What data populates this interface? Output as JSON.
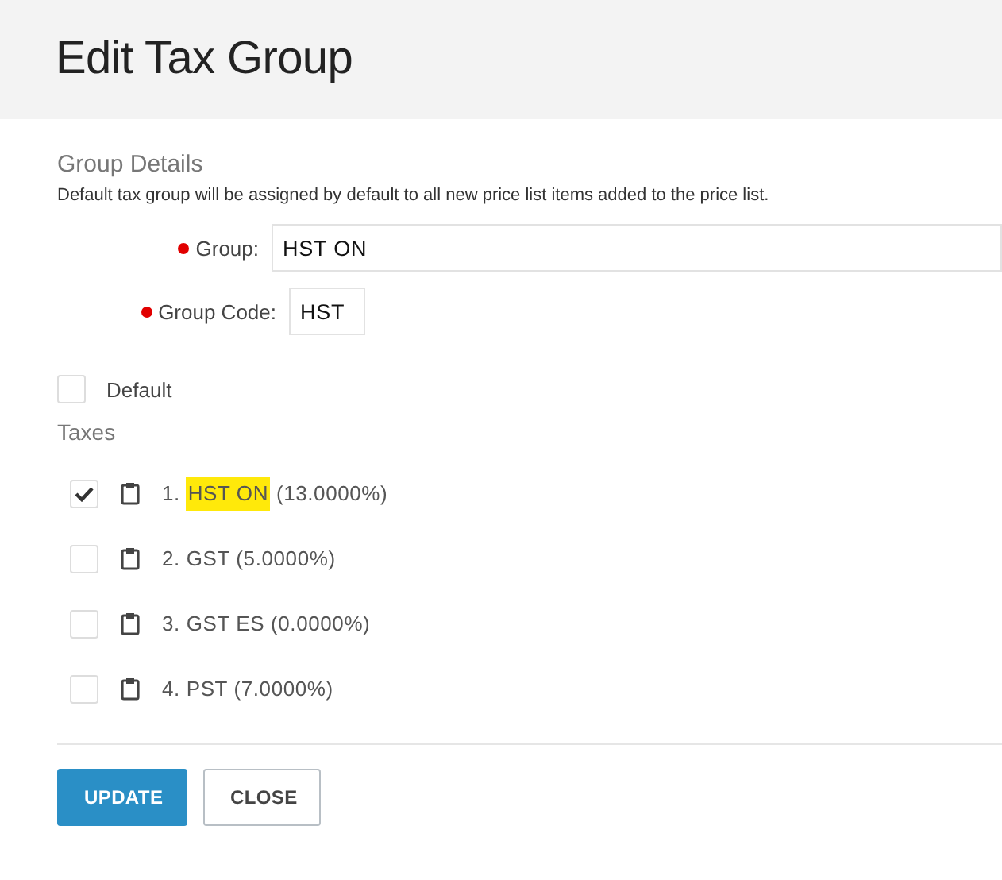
{
  "title": "Edit Tax Group",
  "section": {
    "heading": "Group Details",
    "description": "Default tax group will be assigned by default to all new price list items added to the price list."
  },
  "fields": [
    {
      "label": "Group:",
      "value": "HST ON",
      "required": true,
      "kind": "wide"
    },
    {
      "label": "Group Code:",
      "value": "HST",
      "required": true,
      "kind": "short"
    }
  ],
  "default_option": {
    "label": "Default",
    "checked": false
  },
  "taxes_heading": "Taxes",
  "taxes": [
    {
      "number": "1.",
      "name": "HST ON",
      "rate": "(13.0000%)",
      "checked": true,
      "highlighted": true
    },
    {
      "number": "2.",
      "name": "GST",
      "rate": "(5.0000%)",
      "checked": false,
      "highlighted": false
    },
    {
      "number": "3.",
      "name": "GST ES",
      "rate": "(0.0000%)",
      "checked": false,
      "highlighted": false
    },
    {
      "number": "4.",
      "name": "PST",
      "rate": "(7.0000%)",
      "checked": false,
      "highlighted": false
    }
  ],
  "buttons": [
    {
      "label": "UPDATE",
      "kind": "primary"
    },
    {
      "label": "CLOSE",
      "kind": "secondary"
    }
  ]
}
